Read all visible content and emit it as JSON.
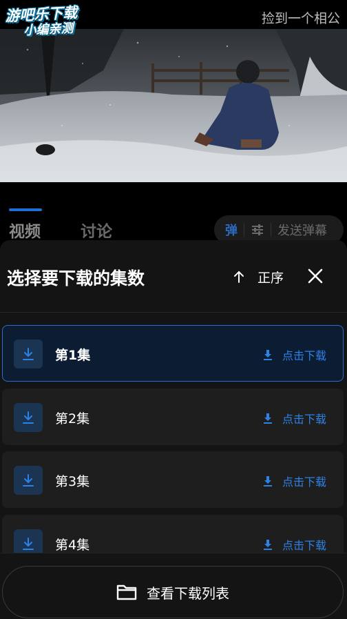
{
  "header": {
    "logo_line1": "游吧乐下载",
    "logo_line2": "小编亲测",
    "marquee_text": "捡到一个相公"
  },
  "tabs": {
    "video": "视频",
    "discuss": "讨论"
  },
  "danmaku": {
    "toggle_label": "弹",
    "send_placeholder": "发送弹幕"
  },
  "sheet": {
    "title": "选择要下载的集数",
    "sort_label": "正序",
    "episodes": [
      {
        "label": "第1集",
        "action": "点击下载",
        "selected": true
      },
      {
        "label": "第2集",
        "action": "点击下载",
        "selected": false
      },
      {
        "label": "第3集",
        "action": "点击下载",
        "selected": false
      },
      {
        "label": "第4集",
        "action": "点击下载",
        "selected": false
      }
    ],
    "view_list_label": "查看下载列表"
  },
  "colors": {
    "accent": "#2d82e8",
    "selected_bg": "#0c1d33",
    "sheet_bg": "#141414"
  }
}
